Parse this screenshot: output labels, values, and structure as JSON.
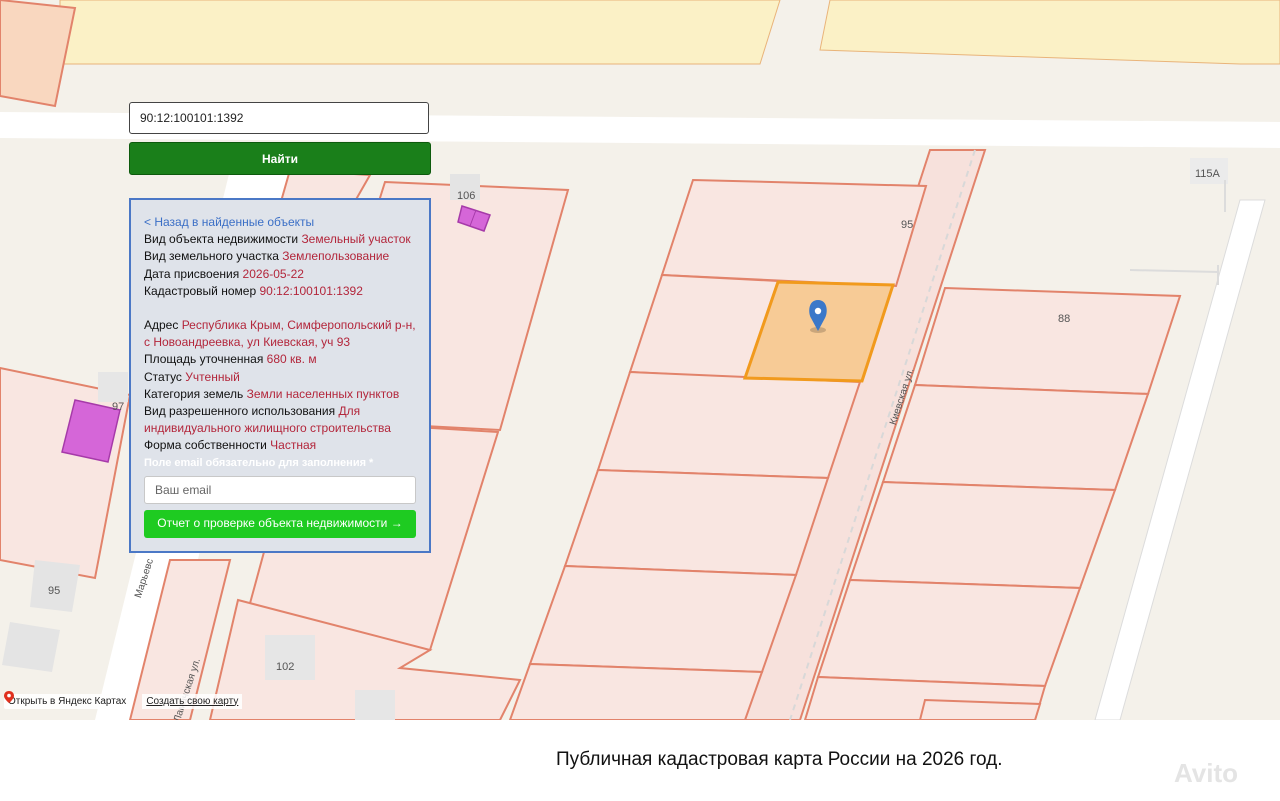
{
  "search": {
    "value": "90:12:100101:1392",
    "button_label": "Найти"
  },
  "info": {
    "back_link": "< Назад в найденные объекты",
    "rows": [
      {
        "label": "Вид объекта недвижимости",
        "value": "Земельный участок"
      },
      {
        "label": "Вид земельного участка",
        "value": "Землепользование"
      },
      {
        "label": "Дата присвоения",
        "value": "2026-05-22"
      },
      {
        "label": "Кадастровый номер",
        "value": "90:12:100101:1392"
      }
    ],
    "address_label": "Адрес",
    "address_value": "Республика Крым, Симферопольский р-н, с Новоандреевка, ул Киевская, уч 93",
    "area_label": "Площадь уточненная",
    "area_value": "680 кв. м",
    "status_label": "Статус",
    "status_value": "Учтенный",
    "category_label": "Категория земель",
    "category_value": "Земли населенных пунктов",
    "use_label": "Вид разрешенного использования",
    "use_value": "Для индивидуального жилищного строительства",
    "ownership_label": "Форма собственности",
    "ownership_value": "Частная",
    "email_required": "Поле email обязательно для заполнения *",
    "email_placeholder": "Ваш email",
    "report_button": "Отчет о проверке объекта недвижимости →"
  },
  "map_labels": {
    "n106": "106",
    "n115a": "115А",
    "n95_top": "95",
    "n88": "88",
    "n97": "97",
    "n95_left": "95",
    "n102": "102",
    "street_kievskaya": "Киевская ул.",
    "street_maryevskaya": "Марьевс",
    "street_lower": "Ламачская ул."
  },
  "yandex": {
    "open_label": "Открыть в Яндекс Картах",
    "create_label": "Создать свою карту"
  },
  "caption": "Публичная кадастровая карта России на 2026 год.",
  "watermark": "Avito",
  "colors": {
    "parcel_fill": "#f9e6e1",
    "parcel_stroke": "#e2836b",
    "selected_fill": "#f7cb96",
    "selected_stroke": "#f19a1d",
    "building_fill": "#d566d8",
    "zone_fill": "#fbf1c6",
    "search_button": "#1a7f1a",
    "report_button": "#1ecb21",
    "panel_border": "#4b78c6"
  }
}
